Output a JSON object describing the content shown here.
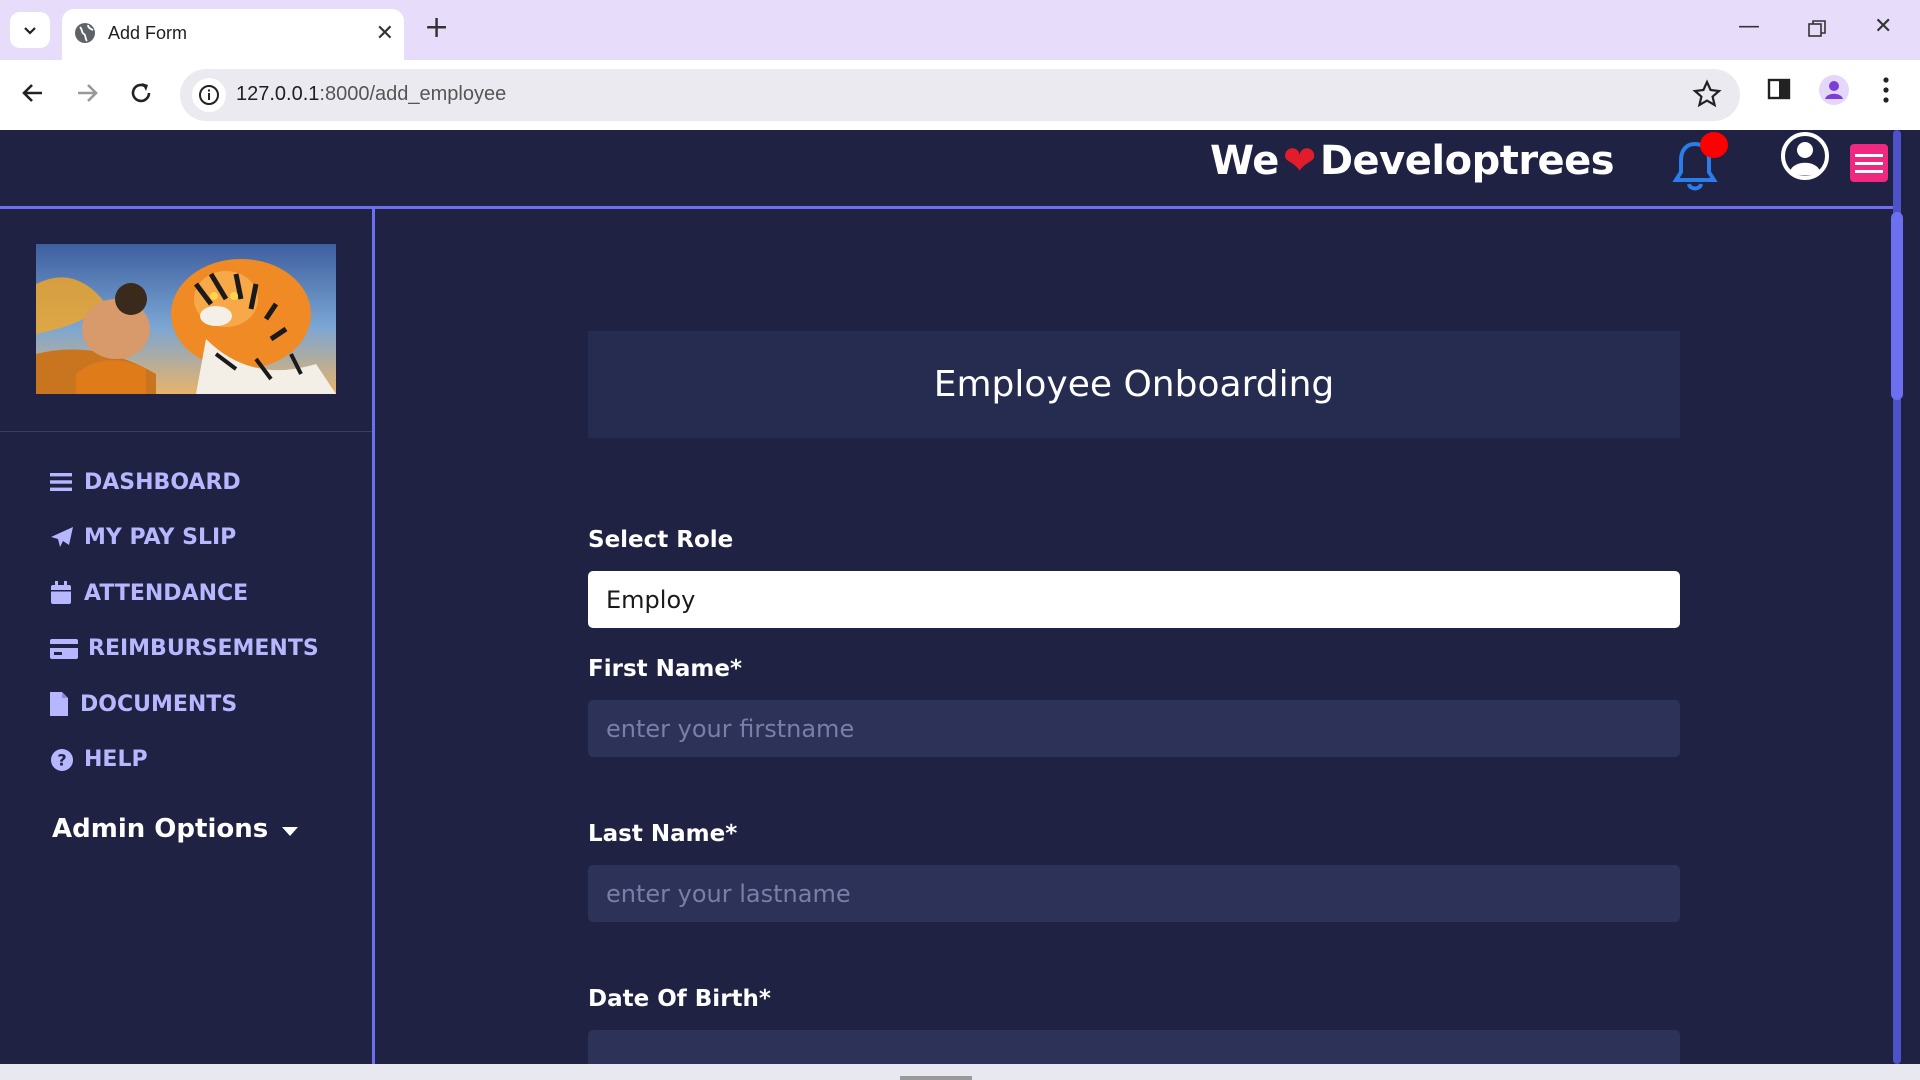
{
  "browser": {
    "tab_title": "Add Form",
    "url_host": "127.0.0.1",
    "url_path": ":8000/add_employee",
    "icons": {
      "tab_menu": "chevron-down-icon",
      "tab_favicon": "globe-icon",
      "tab_close": "close-icon",
      "new_tab": "plus-icon",
      "back": "arrow-left-icon",
      "forward": "arrow-right-icon",
      "reload": "reload-icon",
      "site_info": "info-icon",
      "bookmark": "star-icon",
      "side_panel": "side-panel-icon",
      "profile": "profile-icon",
      "browser_menu": "kebab-menu-icon"
    }
  },
  "header": {
    "brand_prefix": "We",
    "brand_heart": "❤",
    "brand_suffix": "Developtrees",
    "colors": {
      "accent": "#6b6ff0",
      "bell": "#2b7de9",
      "notification_dot": "#ff0000",
      "menu_button": "#f0287f"
    }
  },
  "sidebar": {
    "items": [
      {
        "label": "DASHBOARD",
        "icon": "bars-icon"
      },
      {
        "label": "MY PAY SLIP",
        "icon": "paper-plane-icon"
      },
      {
        "label": "ATTENDANCE",
        "icon": "calendar-icon"
      },
      {
        "label": "REIMBURSEMENTS",
        "icon": "credit-card-icon"
      },
      {
        "label": "DOCUMENTS",
        "icon": "file-icon"
      },
      {
        "label": "HELP",
        "icon": "question-circle-icon"
      }
    ],
    "admin_label": "Admin Options"
  },
  "form": {
    "title": "Employee Onboarding",
    "role_label": "Select Role",
    "role_value": "Employ",
    "first_name_label": "First Name*",
    "first_name_placeholder": "enter your firstname",
    "last_name_label": "Last Name*",
    "last_name_placeholder": "enter your lastname",
    "dob_label": "Date Of Birth*"
  }
}
